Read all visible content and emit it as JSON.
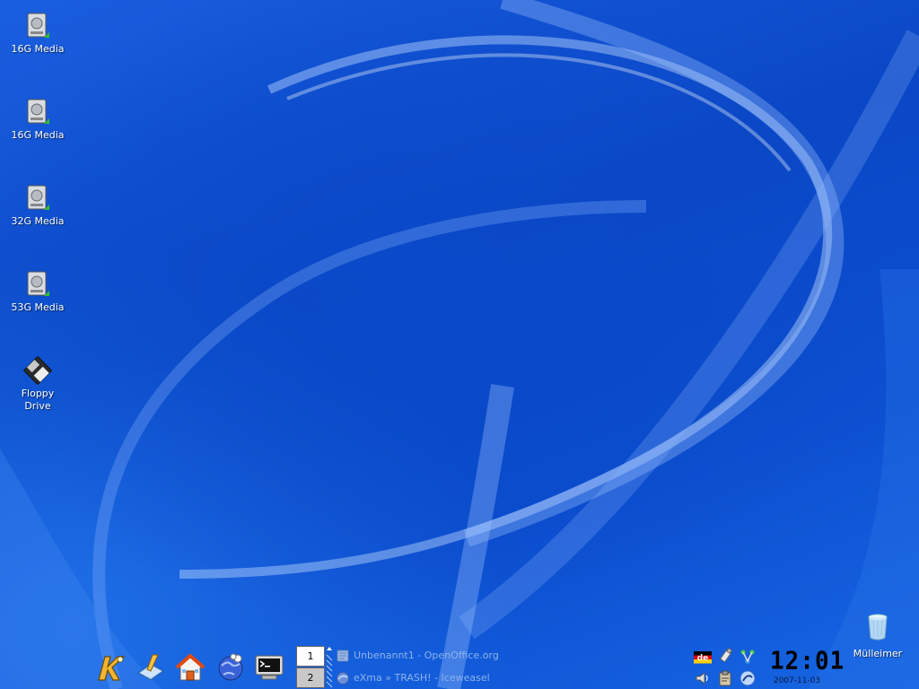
{
  "desktop": {
    "icons": [
      {
        "label": "16G Media",
        "icon": "hard-drive-icon"
      },
      {
        "label": "16G Media",
        "icon": "hard-drive-icon"
      },
      {
        "label": "32G Media",
        "icon": "hard-drive-icon"
      },
      {
        "label": "53G Media",
        "icon": "hard-drive-icon"
      },
      {
        "label": "Floppy\nDrive",
        "line1": "Floppy",
        "line2": "Drive",
        "icon": "floppy-icon"
      }
    ],
    "trash": {
      "label": "Mülleimer",
      "icon": "trash-icon"
    }
  },
  "panel": {
    "launchers": [
      {
        "name": "kde-menu-button",
        "icon": "kde-k-icon"
      },
      {
        "name": "desktop-button",
        "icon": "show-desktop-icon"
      },
      {
        "name": "home-button",
        "icon": "home-icon"
      },
      {
        "name": "browser-button",
        "icon": "konqueror-globe-icon"
      },
      {
        "name": "terminal-button",
        "icon": "terminal-icon"
      }
    ],
    "pager": {
      "desk1": "1",
      "desk2": "2"
    },
    "tasks": [
      {
        "label": "Unbenannt1 - OpenOffice.org",
        "icon": "openoffice-icon"
      },
      {
        "label": "eXma » TRASH! - Iceweasel",
        "icon": "iceweasel-icon"
      }
    ],
    "tray": {
      "keyboard_layout": "de",
      "icons": [
        "flag-de-icon",
        "usb-icon",
        "network-icon",
        "volume-icon",
        "klipper-icon",
        "update-icon"
      ]
    },
    "clock": {
      "time": "12:01",
      "date": "2007-11-03"
    }
  },
  "colors": {
    "desktop_blue": "#0a47c6",
    "label_text": "#ffffff"
  }
}
